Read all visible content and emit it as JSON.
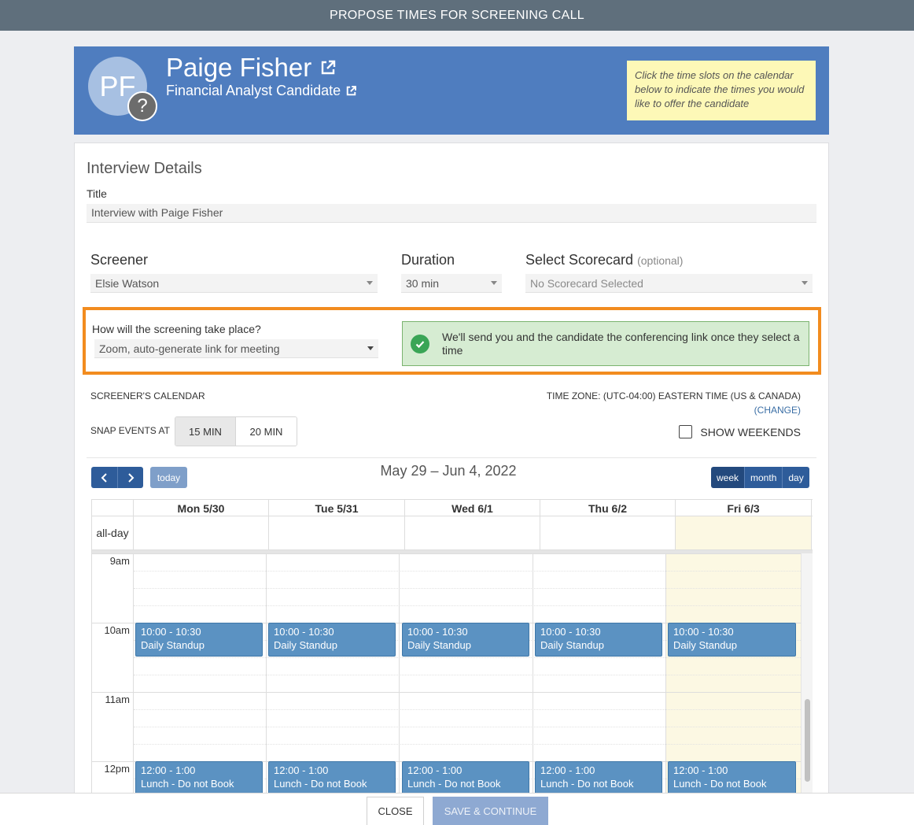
{
  "modal": {
    "title": "PROPOSE TIMES FOR SCREENING CALL"
  },
  "candidate": {
    "initials": "PF",
    "badge": "?",
    "name": "Paige Fisher",
    "role": "Financial Analyst Candidate",
    "hint": "Click the time slots on the calendar below to indicate the times you would like to offer the candidate"
  },
  "details": {
    "heading": "Interview Details",
    "title_label": "Title",
    "title_value": "Interview with Paige Fisher",
    "screener_label": "Screener",
    "screener_value": "Elsie Watson",
    "duration_label": "Duration",
    "duration_value": "30 min",
    "scorecard_label": "Select Scorecard",
    "scorecard_optional": "(optional)",
    "scorecard_value": "No Scorecard Selected",
    "location_label": "How will the screening take place?",
    "location_value": "Zoom, auto-generate link for meeting",
    "location_note": "We'll send you and the candidate the conferencing link once they select a time"
  },
  "calendar_settings": {
    "section_label": "SCREENER'S CALENDAR",
    "timezone": "TIME ZONE: (UTC-04:00) EASTERN TIME (US & CANADA)",
    "change_link": "(CHANGE)",
    "snap_label": "SNAP EVENTS AT",
    "snap_options": [
      "15 MIN",
      "20 MIN"
    ],
    "snap_selected": "15 MIN",
    "weekends_label": "SHOW WEEKENDS",
    "weekends_checked": false
  },
  "calendar": {
    "range": "May 29 – Jun 4, 2022",
    "today_label": "today",
    "views": [
      "week",
      "month",
      "day"
    ],
    "all_day_label": "all-day",
    "days": [
      "Mon 5/30",
      "Tue 5/31",
      "Wed 6/1",
      "Thu 6/2",
      "Fri 6/3"
    ],
    "today_index": 4,
    "hours": [
      "9am",
      "10am",
      "11am",
      "12pm"
    ],
    "events": [
      {
        "time": "10:00 - 10:30",
        "title": "Daily Standup"
      },
      {
        "time": "12:00 - 1:00",
        "title": "Lunch - Do not Book"
      }
    ]
  },
  "footer": {
    "close": "CLOSE",
    "save": "SAVE & CONTINUE"
  },
  "colors": {
    "accent": "#2e5c9a",
    "highlight_border": "#f28c1f",
    "event": "#5b92c2",
    "today_bg": "#fcf8e3"
  }
}
